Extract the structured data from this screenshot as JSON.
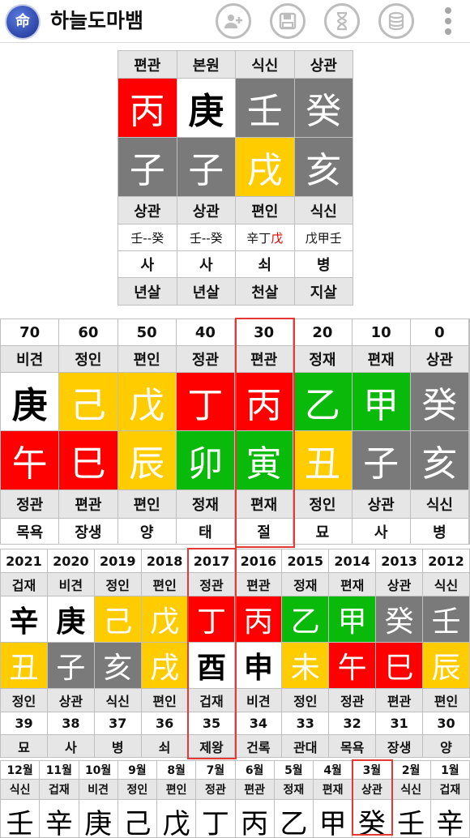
{
  "app": {
    "title": "하늘도마뱀",
    "logo": "命",
    "icons": [
      "add-user-icon",
      "save-icon",
      "hourglass-icon",
      "database-icon"
    ]
  },
  "natal": {
    "tengods_top": [
      "편관",
      "본원",
      "식신",
      "상관"
    ],
    "stems": [
      "丙",
      "庚",
      "壬",
      "癸"
    ],
    "branches": [
      "子",
      "子",
      "戌",
      "亥"
    ],
    "tengods_bottom": [
      "상관",
      "상관",
      "편인",
      "식신"
    ],
    "hidden": [
      "壬--癸",
      "壬--癸",
      "辛丁",
      "戊甲壬"
    ],
    "hidden_extra": "戊",
    "stage": [
      "사",
      "사",
      "쇠",
      "병"
    ],
    "sal": [
      "년살",
      "년살",
      "천살",
      "지살"
    ]
  },
  "daewoon": {
    "ages": [
      "70",
      "60",
      "50",
      "40",
      "30",
      "20",
      "10",
      "0"
    ],
    "tengods_top": [
      "비견",
      "정인",
      "편인",
      "정관",
      "편관",
      "정재",
      "편재",
      "상관"
    ],
    "stems": [
      "庚",
      "己",
      "戊",
      "丁",
      "丙",
      "乙",
      "甲",
      "癸"
    ],
    "branches": [
      "午",
      "巳",
      "辰",
      "卯",
      "寅",
      "丑",
      "子",
      "亥"
    ],
    "tengods_bottom": [
      "정관",
      "편관",
      "편인",
      "정재",
      "편재",
      "정인",
      "상관",
      "식신"
    ],
    "stage": [
      "목욕",
      "장생",
      "양",
      "태",
      "절",
      "묘",
      "사",
      "병"
    ]
  },
  "yearly": {
    "years": [
      "2021",
      "2020",
      "2019",
      "2018",
      "2017",
      "2016",
      "2015",
      "2014",
      "2013",
      "2012"
    ],
    "tengods_top": [
      "겁재",
      "비견",
      "정인",
      "편인",
      "정관",
      "편관",
      "정재",
      "편재",
      "상관",
      "식신"
    ],
    "stems": [
      "辛",
      "庚",
      "己",
      "戊",
      "丁",
      "丙",
      "乙",
      "甲",
      "癸",
      "壬"
    ],
    "branches": [
      "丑",
      "子",
      "亥",
      "戌",
      "酉",
      "申",
      "未",
      "午",
      "巳",
      "辰"
    ],
    "tengods_bottom": [
      "정인",
      "상관",
      "식신",
      "편인",
      "겁재",
      "비견",
      "정인",
      "정관",
      "편관",
      "편인"
    ],
    "ages": [
      "39",
      "38",
      "37",
      "36",
      "35",
      "34",
      "33",
      "32",
      "31",
      "30"
    ],
    "stage": [
      "묘",
      "사",
      "병",
      "쇠",
      "제왕",
      "건록",
      "관대",
      "목욕",
      "장생",
      "양"
    ]
  },
  "monthly": {
    "months": [
      "12월",
      "11월",
      "10월",
      "9월",
      "8월",
      "7월",
      "6월",
      "5월",
      "4월",
      "3월",
      "2월",
      "1월"
    ],
    "tengods": [
      "식신",
      "겁재",
      "비견",
      "정인",
      "편인",
      "정관",
      "편관",
      "정재",
      "편재",
      "상관",
      "식신",
      "겁재"
    ],
    "stems": [
      "壬",
      "辛",
      "庚",
      "己",
      "戊",
      "丁",
      "丙",
      "乙",
      "甲",
      "癸",
      "壬",
      "辛"
    ]
  },
  "colors": {
    "fire": "#ff0000",
    "earth": "#ffcc00",
    "wood": "#0aba0a",
    "water": "#7a7a7a",
    "metal": "#ffffff",
    "highlight": "#e53935"
  }
}
